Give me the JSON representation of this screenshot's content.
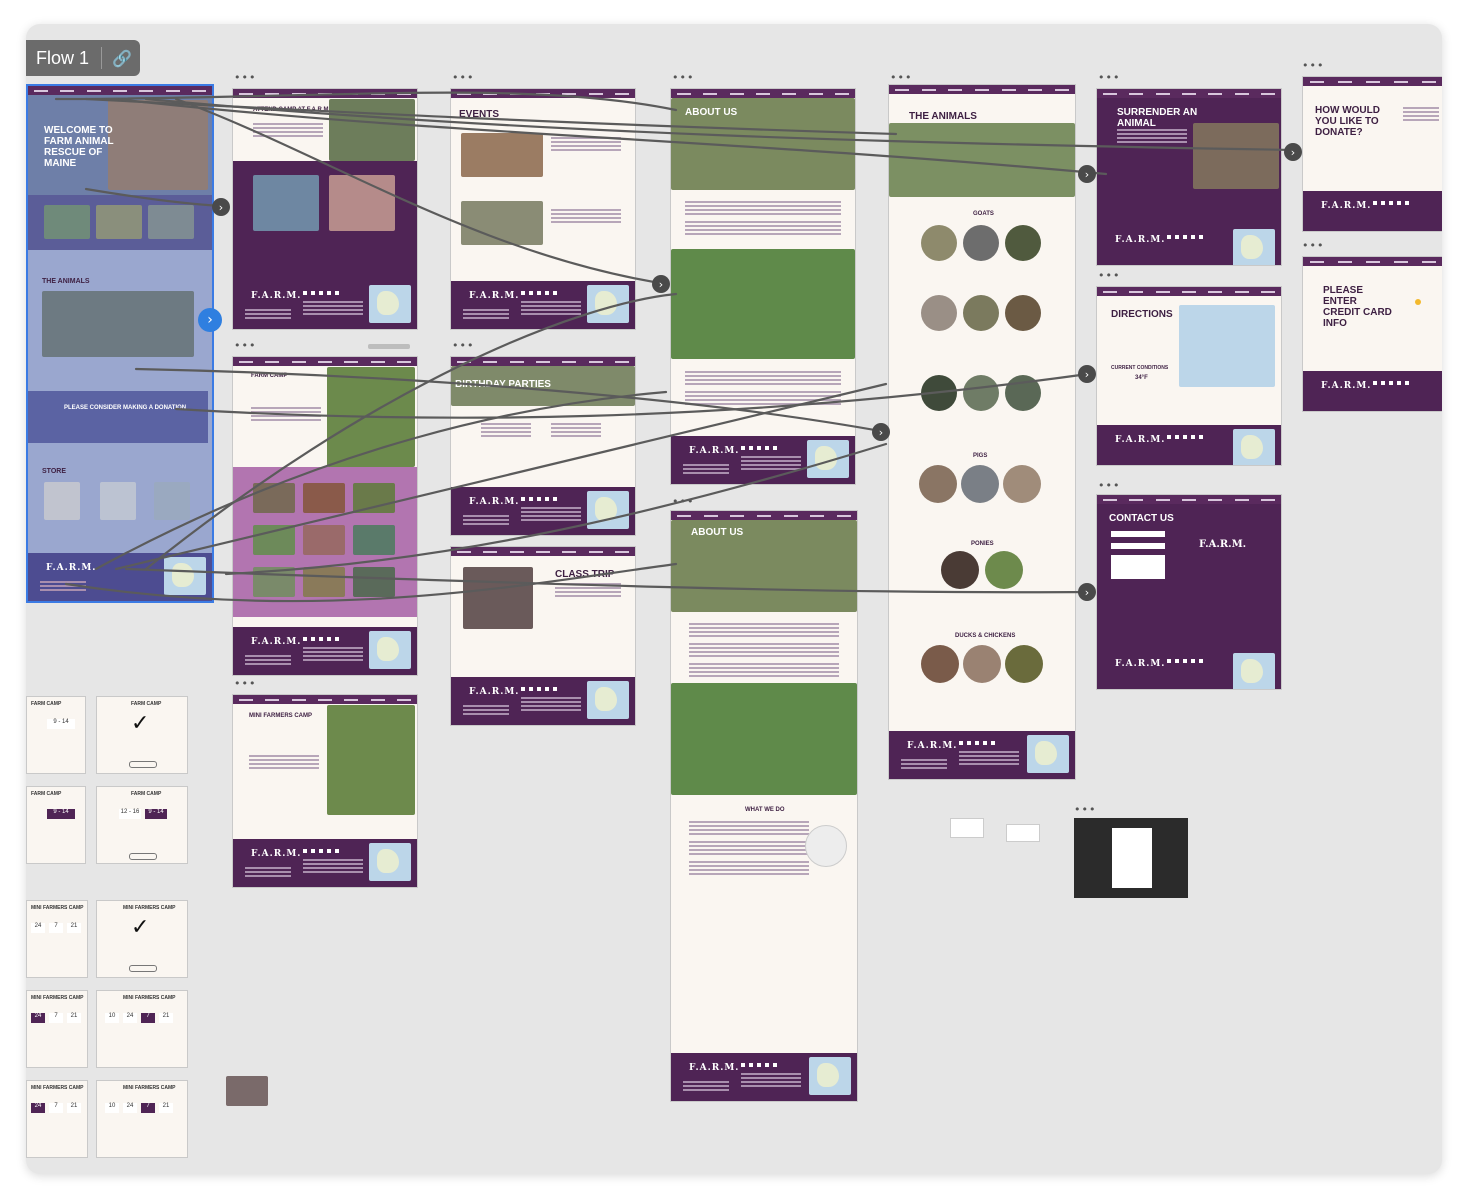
{
  "flow": {
    "title": "Flow 1",
    "link_icon": "link-icon"
  },
  "home": {
    "hero_title": "WELCOME TO FARM ANIMAL RESCUE OF MAINE",
    "animals_heading": "THE ANIMALS",
    "donate_heading": "PLEASE CONSIDER MAKING A DONATION",
    "store_heading": "STORE",
    "logo": "F.A.R.M."
  },
  "frames": {
    "farm_camp": "ATTEND CAMP AT F.A.R.M",
    "events": "EVENTS",
    "about_us": "ABOUT US",
    "the_animals": "THE ANIMALS",
    "goats": "GOATS",
    "pigs": "PIGS",
    "ponies": "PONIES",
    "ducks_chickens": "DUCKS & CHICKENS",
    "surrender": "SURRENDER AN ANIMAL",
    "donate": "HOW WOULD YOU LIKE TO DONATE?",
    "credit_card": "PLEASE ENTER CREDIT CARD INFO",
    "directions": "DIRECTIONS",
    "current_conditions": "CURRENT CONDITIONS",
    "temperature": "34°F",
    "contact": "CONTACT US",
    "farm_camp_detail": "FARM CAMP",
    "birthday": "BIRTHDAY PARTIES",
    "class_trip": "CLASS TRIP",
    "mini_farmers": "MINI FARMERS CAMP",
    "about_us_2": "ABOUT US",
    "what_we_do": "WHAT WE DO"
  },
  "booking": {
    "farm_camp": "FARM CAMP",
    "mini_farmers": "MINI FARMERS CAMP",
    "age_a": "9 - 14",
    "age_b": "12 - 16",
    "age_c": "9 - 14",
    "num_24": "24",
    "num_7": "7",
    "num_21": "21",
    "num_10": "10",
    "check": "✓"
  },
  "colors": {
    "purple": "#4f2455",
    "canvas": "#e6e6e6",
    "accent_blue": "#2f7fe0"
  }
}
